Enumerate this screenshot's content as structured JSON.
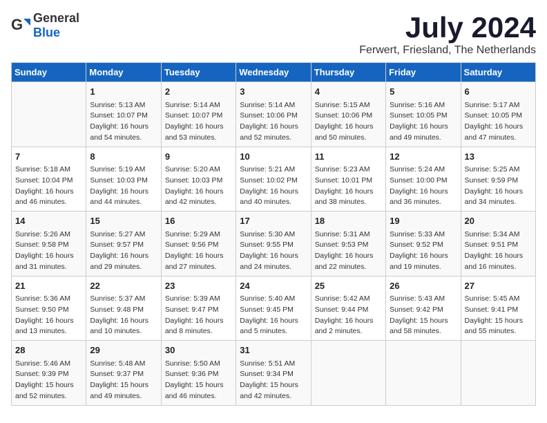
{
  "header": {
    "logo_general": "General",
    "logo_blue": "Blue",
    "title": "July 2024",
    "location": "Ferwert, Friesland, The Netherlands"
  },
  "days_of_week": [
    "Sunday",
    "Monday",
    "Tuesday",
    "Wednesday",
    "Thursday",
    "Friday",
    "Saturday"
  ],
  "weeks": [
    [
      {
        "day": "",
        "content": ""
      },
      {
        "day": "1",
        "sunrise": "Sunrise: 5:13 AM",
        "sunset": "Sunset: 10:07 PM",
        "daylight": "Daylight: 16 hours",
        "minutes": "and 54 minutes."
      },
      {
        "day": "2",
        "sunrise": "Sunrise: 5:14 AM",
        "sunset": "Sunset: 10:07 PM",
        "daylight": "Daylight: 16 hours",
        "minutes": "and 53 minutes."
      },
      {
        "day": "3",
        "sunrise": "Sunrise: 5:14 AM",
        "sunset": "Sunset: 10:06 PM",
        "daylight": "Daylight: 16 hours",
        "minutes": "and 52 minutes."
      },
      {
        "day": "4",
        "sunrise": "Sunrise: 5:15 AM",
        "sunset": "Sunset: 10:06 PM",
        "daylight": "Daylight: 16 hours",
        "minutes": "and 50 minutes."
      },
      {
        "day": "5",
        "sunrise": "Sunrise: 5:16 AM",
        "sunset": "Sunset: 10:05 PM",
        "daylight": "Daylight: 16 hours",
        "minutes": "and 49 minutes."
      },
      {
        "day": "6",
        "sunrise": "Sunrise: 5:17 AM",
        "sunset": "Sunset: 10:05 PM",
        "daylight": "Daylight: 16 hours",
        "minutes": "and 47 minutes."
      }
    ],
    [
      {
        "day": "7",
        "sunrise": "Sunrise: 5:18 AM",
        "sunset": "Sunset: 10:04 PM",
        "daylight": "Daylight: 16 hours",
        "minutes": "and 46 minutes."
      },
      {
        "day": "8",
        "sunrise": "Sunrise: 5:19 AM",
        "sunset": "Sunset: 10:03 PM",
        "daylight": "Daylight: 16 hours",
        "minutes": "and 44 minutes."
      },
      {
        "day": "9",
        "sunrise": "Sunrise: 5:20 AM",
        "sunset": "Sunset: 10:03 PM",
        "daylight": "Daylight: 16 hours",
        "minutes": "and 42 minutes."
      },
      {
        "day": "10",
        "sunrise": "Sunrise: 5:21 AM",
        "sunset": "Sunset: 10:02 PM",
        "daylight": "Daylight: 16 hours",
        "minutes": "and 40 minutes."
      },
      {
        "day": "11",
        "sunrise": "Sunrise: 5:23 AM",
        "sunset": "Sunset: 10:01 PM",
        "daylight": "Daylight: 16 hours",
        "minutes": "and 38 minutes."
      },
      {
        "day": "12",
        "sunrise": "Sunrise: 5:24 AM",
        "sunset": "Sunset: 10:00 PM",
        "daylight": "Daylight: 16 hours",
        "minutes": "and 36 minutes."
      },
      {
        "day": "13",
        "sunrise": "Sunrise: 5:25 AM",
        "sunset": "Sunset: 9:59 PM",
        "daylight": "Daylight: 16 hours",
        "minutes": "and 34 minutes."
      }
    ],
    [
      {
        "day": "14",
        "sunrise": "Sunrise: 5:26 AM",
        "sunset": "Sunset: 9:58 PM",
        "daylight": "Daylight: 16 hours",
        "minutes": "and 31 minutes."
      },
      {
        "day": "15",
        "sunrise": "Sunrise: 5:27 AM",
        "sunset": "Sunset: 9:57 PM",
        "daylight": "Daylight: 16 hours",
        "minutes": "and 29 minutes."
      },
      {
        "day": "16",
        "sunrise": "Sunrise: 5:29 AM",
        "sunset": "Sunset: 9:56 PM",
        "daylight": "Daylight: 16 hours",
        "minutes": "and 27 minutes."
      },
      {
        "day": "17",
        "sunrise": "Sunrise: 5:30 AM",
        "sunset": "Sunset: 9:55 PM",
        "daylight": "Daylight: 16 hours",
        "minutes": "and 24 minutes."
      },
      {
        "day": "18",
        "sunrise": "Sunrise: 5:31 AM",
        "sunset": "Sunset: 9:53 PM",
        "daylight": "Daylight: 16 hours",
        "minutes": "and 22 minutes."
      },
      {
        "day": "19",
        "sunrise": "Sunrise: 5:33 AM",
        "sunset": "Sunset: 9:52 PM",
        "daylight": "Daylight: 16 hours",
        "minutes": "and 19 minutes."
      },
      {
        "day": "20",
        "sunrise": "Sunrise: 5:34 AM",
        "sunset": "Sunset: 9:51 PM",
        "daylight": "Daylight: 16 hours",
        "minutes": "and 16 minutes."
      }
    ],
    [
      {
        "day": "21",
        "sunrise": "Sunrise: 5:36 AM",
        "sunset": "Sunset: 9:50 PM",
        "daylight": "Daylight: 16 hours",
        "minutes": "and 13 minutes."
      },
      {
        "day": "22",
        "sunrise": "Sunrise: 5:37 AM",
        "sunset": "Sunset: 9:48 PM",
        "daylight": "Daylight: 16 hours",
        "minutes": "and 10 minutes."
      },
      {
        "day": "23",
        "sunrise": "Sunrise: 5:39 AM",
        "sunset": "Sunset: 9:47 PM",
        "daylight": "Daylight: 16 hours",
        "minutes": "and 8 minutes."
      },
      {
        "day": "24",
        "sunrise": "Sunrise: 5:40 AM",
        "sunset": "Sunset: 9:45 PM",
        "daylight": "Daylight: 16 hours",
        "minutes": "and 5 minutes."
      },
      {
        "day": "25",
        "sunrise": "Sunrise: 5:42 AM",
        "sunset": "Sunset: 9:44 PM",
        "daylight": "Daylight: 16 hours",
        "minutes": "and 2 minutes."
      },
      {
        "day": "26",
        "sunrise": "Sunrise: 5:43 AM",
        "sunset": "Sunset: 9:42 PM",
        "daylight": "Daylight: 15 hours",
        "minutes": "and 58 minutes."
      },
      {
        "day": "27",
        "sunrise": "Sunrise: 5:45 AM",
        "sunset": "Sunset: 9:41 PM",
        "daylight": "Daylight: 15 hours",
        "minutes": "and 55 minutes."
      }
    ],
    [
      {
        "day": "28",
        "sunrise": "Sunrise: 5:46 AM",
        "sunset": "Sunset: 9:39 PM",
        "daylight": "Daylight: 15 hours",
        "minutes": "and 52 minutes."
      },
      {
        "day": "29",
        "sunrise": "Sunrise: 5:48 AM",
        "sunset": "Sunset: 9:37 PM",
        "daylight": "Daylight: 15 hours",
        "minutes": "and 49 minutes."
      },
      {
        "day": "30",
        "sunrise": "Sunrise: 5:50 AM",
        "sunset": "Sunset: 9:36 PM",
        "daylight": "Daylight: 15 hours",
        "minutes": "and 46 minutes."
      },
      {
        "day": "31",
        "sunrise": "Sunrise: 5:51 AM",
        "sunset": "Sunset: 9:34 PM",
        "daylight": "Daylight: 15 hours",
        "minutes": "and 42 minutes."
      },
      {
        "day": "",
        "content": ""
      },
      {
        "day": "",
        "content": ""
      },
      {
        "day": "",
        "content": ""
      }
    ]
  ]
}
